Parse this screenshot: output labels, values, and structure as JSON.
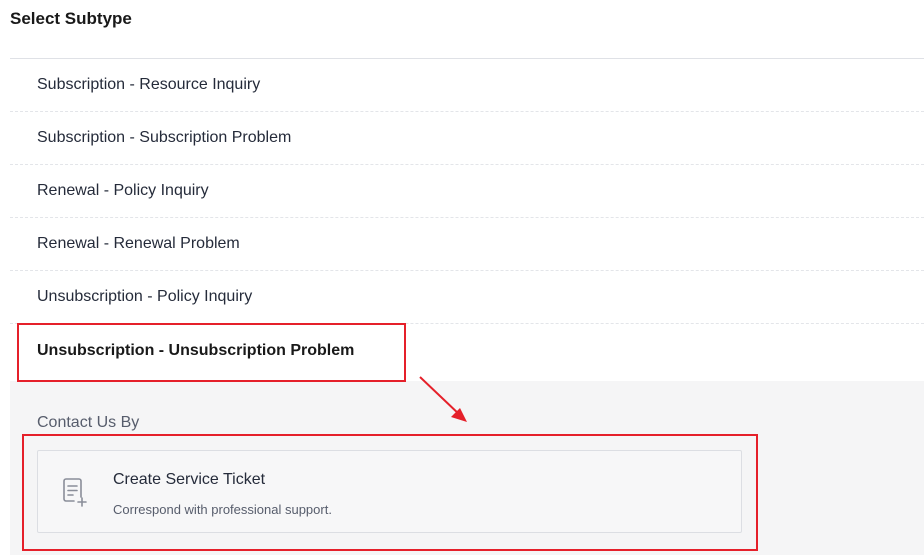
{
  "header": {
    "title": "Select Subtype"
  },
  "subtypes": [
    {
      "label": "Subscription - Resource Inquiry"
    },
    {
      "label": "Subscription - Subscription Problem"
    },
    {
      "label": "Renewal - Policy Inquiry"
    },
    {
      "label": "Renewal - Renewal Problem"
    },
    {
      "label": "Unsubscription - Policy Inquiry"
    },
    {
      "label": "Unsubscription - Unsubscription Problem",
      "selected": true
    }
  ],
  "contact": {
    "label": "Contact Us By",
    "options": [
      {
        "icon": "ticket-add-icon",
        "title": "Create Service Ticket",
        "description": "Correspond with professional support."
      }
    ]
  },
  "annotations": {
    "highlight_color": "#e5202a"
  }
}
